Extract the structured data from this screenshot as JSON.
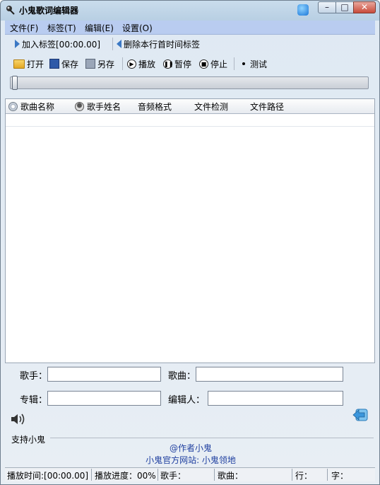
{
  "window": {
    "title": "小鬼歌词编辑器"
  },
  "menu": {
    "items": [
      "文件(F)",
      "标签(T)",
      "编辑(E)",
      "设置(O)"
    ]
  },
  "toolbar": {
    "add_tag": "加入标签[00:00.00]",
    "delete_tag": "删除本行首时间标签",
    "open": "打开",
    "save": "保存",
    "save_as": "另存",
    "play": "播放",
    "pause": "暂停",
    "stop": "停止",
    "test": "测试"
  },
  "progress": {
    "fraction": 0.0
  },
  "table": {
    "columns": [
      "歌曲名称",
      "歌手姓名",
      "音频格式",
      "文件检测",
      "文件路径"
    ]
  },
  "form": {
    "singer_label": "歌手：",
    "singer_value": "",
    "song_label": "歌曲：",
    "song_value": "",
    "album_label": "专辑：",
    "album_value": "",
    "editor_label": "编辑人：",
    "editor_value": ""
  },
  "about": {
    "group_title": "支持小鬼",
    "author": "@作者小鬼",
    "website": "小鬼官方网站: 小鬼领地"
  },
  "status": {
    "play_time": "播放时间:[00:00.00]",
    "play_progress": "播放进度：00%",
    "singer": "歌手：",
    "song": "歌曲：",
    "line": "行：",
    "char": "字："
  },
  "colors": {
    "menubar": "#b9ccf0",
    "accent": "#3b78c4",
    "close": "#c94b3a"
  }
}
